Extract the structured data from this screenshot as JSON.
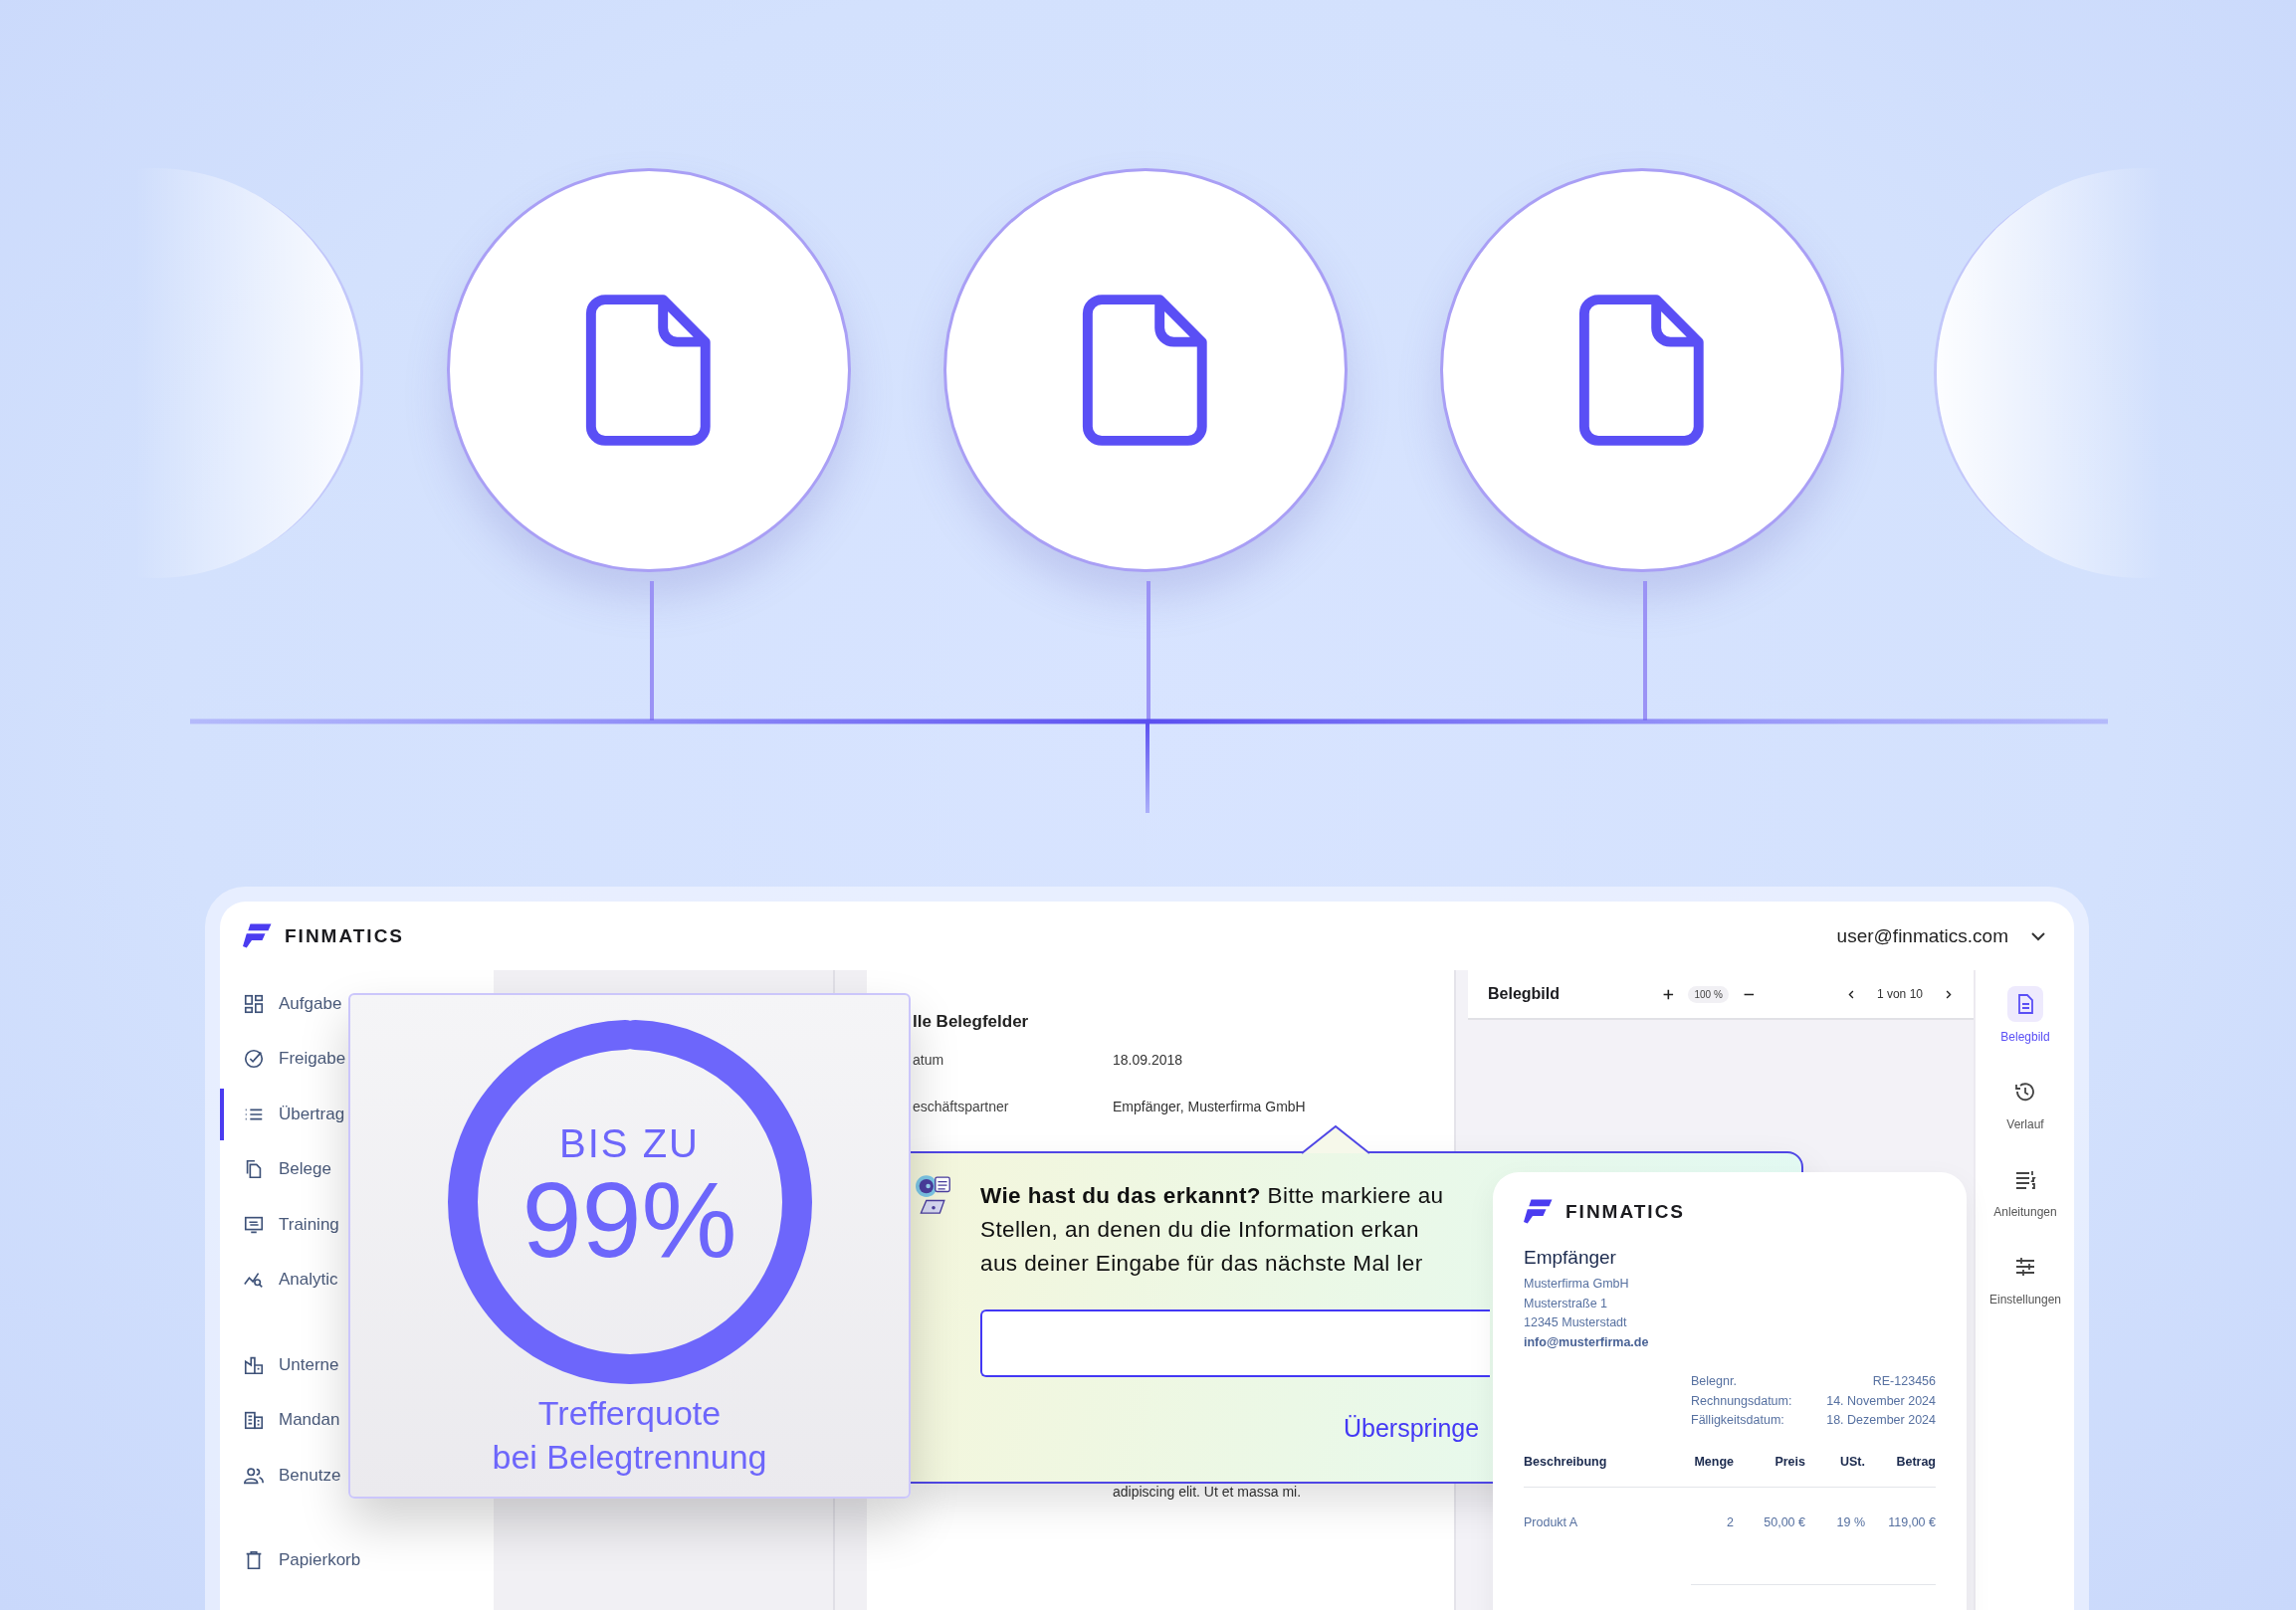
{
  "hero": {
    "nodes": [
      {
        "kind": "faded"
      },
      {
        "kind": "document"
      },
      {
        "kind": "document"
      },
      {
        "kind": "document"
      },
      {
        "kind": "faded"
      }
    ]
  },
  "app": {
    "brand": "FINMATICS",
    "user": "user@finmatics.com",
    "sidebar": {
      "sections": [
        [
          {
            "label": "Aufgabe",
            "kind": "tasks",
            "selected": false
          },
          {
            "label": "Freigabe",
            "kind": "approvals",
            "selected": false
          },
          {
            "label": "Übertrag",
            "kind": "list",
            "selected": true
          },
          {
            "label": "Belege",
            "kind": "documents",
            "selected": false
          },
          {
            "label": "Training",
            "kind": "training",
            "selected": false
          },
          {
            "label": "Analytic",
            "kind": "analytics",
            "selected": false
          }
        ],
        [
          {
            "label": "Unterne",
            "kind": "company",
            "selected": false
          },
          {
            "label": "Mandan",
            "kind": "clients",
            "selected": false
          },
          {
            "label": "Benutze",
            "kind": "users",
            "selected": false
          }
        ],
        [
          {
            "label": "Papierkorb",
            "kind": "trash",
            "selected": false
          }
        ]
      ]
    },
    "fields": {
      "title": "lle Belegfelder",
      "rows": [
        {
          "label": "atum",
          "value": "18.09.2018"
        },
        {
          "label": "eschäftspartner",
          "value": "Empfänger, Musterfirma GmbH"
        }
      ],
      "note": "adipiscing elit. Ut et massa mi."
    },
    "viewer": {
      "title": "Belegbild",
      "zoom": "100 %",
      "page": "1 von 10"
    },
    "rail": [
      {
        "label": "Belegbild",
        "kind": "document",
        "selected": true
      },
      {
        "label": "Verlauf",
        "kind": "history",
        "selected": false
      },
      {
        "label": "Anleitungen",
        "kind": "guide",
        "selected": false
      },
      {
        "label": "Einstellungen",
        "kind": "settings",
        "selected": false
      }
    ]
  },
  "stat_card": {
    "eyebrow": "BIS ZU",
    "value": "99%",
    "level": 0.99,
    "caption": [
      "Trefferquote",
      "bei Belegtrennung"
    ]
  },
  "tooltip": {
    "lines": [
      "**Wie hast du das erkannt?** Bitte markiere au",
      "Stellen, an denen du die Information erkan",
      "aus deiner Eingabe für das nächste Mal ler"
    ],
    "skip": "Überspringe"
  },
  "invoice": {
    "brand": "FINMATICS",
    "recipient_title": "Empfänger",
    "address": [
      "Musterfirma GmbH",
      "Musterstraße 1",
      "12345 Musterstadt"
    ],
    "email": "info@musterfirma.de",
    "meta": [
      {
        "label": "Belegnr.",
        "value": "RE-123456"
      },
      {
        "label": "Rechnungsdatum:",
        "value": "14. November 2024"
      },
      {
        "label": "Fälligkeitsdatum:",
        "value": "18. Dezember 2024"
      }
    ],
    "columns": [
      "Beschreibung",
      "Menge",
      "Preis",
      "USt.",
      "Betrag"
    ],
    "rows": [
      [
        "Produkt A",
        "2",
        "50,00 €",
        "19 %",
        "119,00 €"
      ]
    ]
  }
}
